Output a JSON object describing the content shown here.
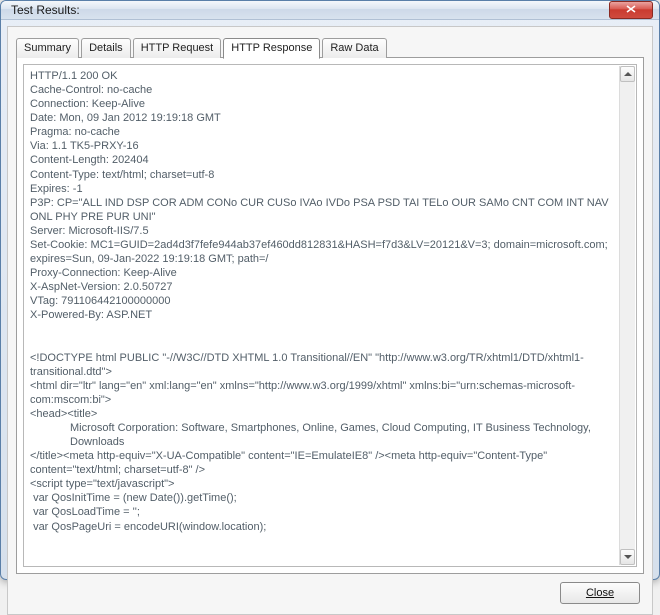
{
  "window": {
    "title": "Test Results:"
  },
  "tabs": [
    {
      "label": "Summary"
    },
    {
      "label": "Details"
    },
    {
      "label": "HTTP Request"
    },
    {
      "label": "HTTP Response"
    },
    {
      "label": "Raw Data"
    }
  ],
  "active_tab": "HTTP Response",
  "response": {
    "headers_text": "HTTP/1.1 200 OK\nCache-Control: no-cache\nConnection: Keep-Alive\nDate: Mon, 09 Jan 2012 19:19:18 GMT\nPragma: no-cache\nVia: 1.1 TK5-PRXY-16\nContent-Length: 202404\nContent-Type: text/html; charset=utf-8\nExpires: -1\nP3P: CP=\"ALL IND DSP COR ADM CONo CUR CUSo IVAo IVDo PSA PSD TAI TELo OUR SAMo CNT COM INT NAV ONL PHY PRE PUR UNI\"\nServer: Microsoft-IIS/7.5\nSet-Cookie: MC1=GUID=2ad4d3f7fefe944ab37ef460dd812831&HASH=f7d3&LV=20121&V=3; domain=microsoft.com; expires=Sun, 09-Jan-2022 19:19:18 GMT; path=/\nProxy-Connection: Keep-Alive\nX-AspNet-Version: 2.0.50727\nVTag: 791106442100000000\nX-Powered-By: ASP.NET",
    "body_pre": "<!DOCTYPE html PUBLIC \"-//W3C//DTD XHTML 1.0 Transitional//EN\" \"http://www.w3.org/TR/xhtml1/DTD/xhtml1-transitional.dtd\">\n<html dir=\"ltr\" lang=\"en\" xml:lang=\"en\" xmlns=\"http://www.w3.org/1999/xhtml\" xmlns:bi=\"urn:schemas-microsoft-com:mscom:bi\">\n<head><title>",
    "body_title_indent": "Microsoft Corporation: Software, Smartphones, Online, Games, Cloud Computing, IT Business Technology, Downloads",
    "body_post": "</title><meta http-equiv=\"X-UA-Compatible\" content=\"IE=EmulateIE8\" /><meta http-equiv=\"Content-Type\" content=\"text/html; charset=utf-8\" />\n<script type=\"text/javascript\">\n var QosInitTime = (new Date()).getTime();\n var QosLoadTime = '';\n var QosPageUri = encodeURI(window.location);"
  },
  "buttons": {
    "close": "Close"
  }
}
